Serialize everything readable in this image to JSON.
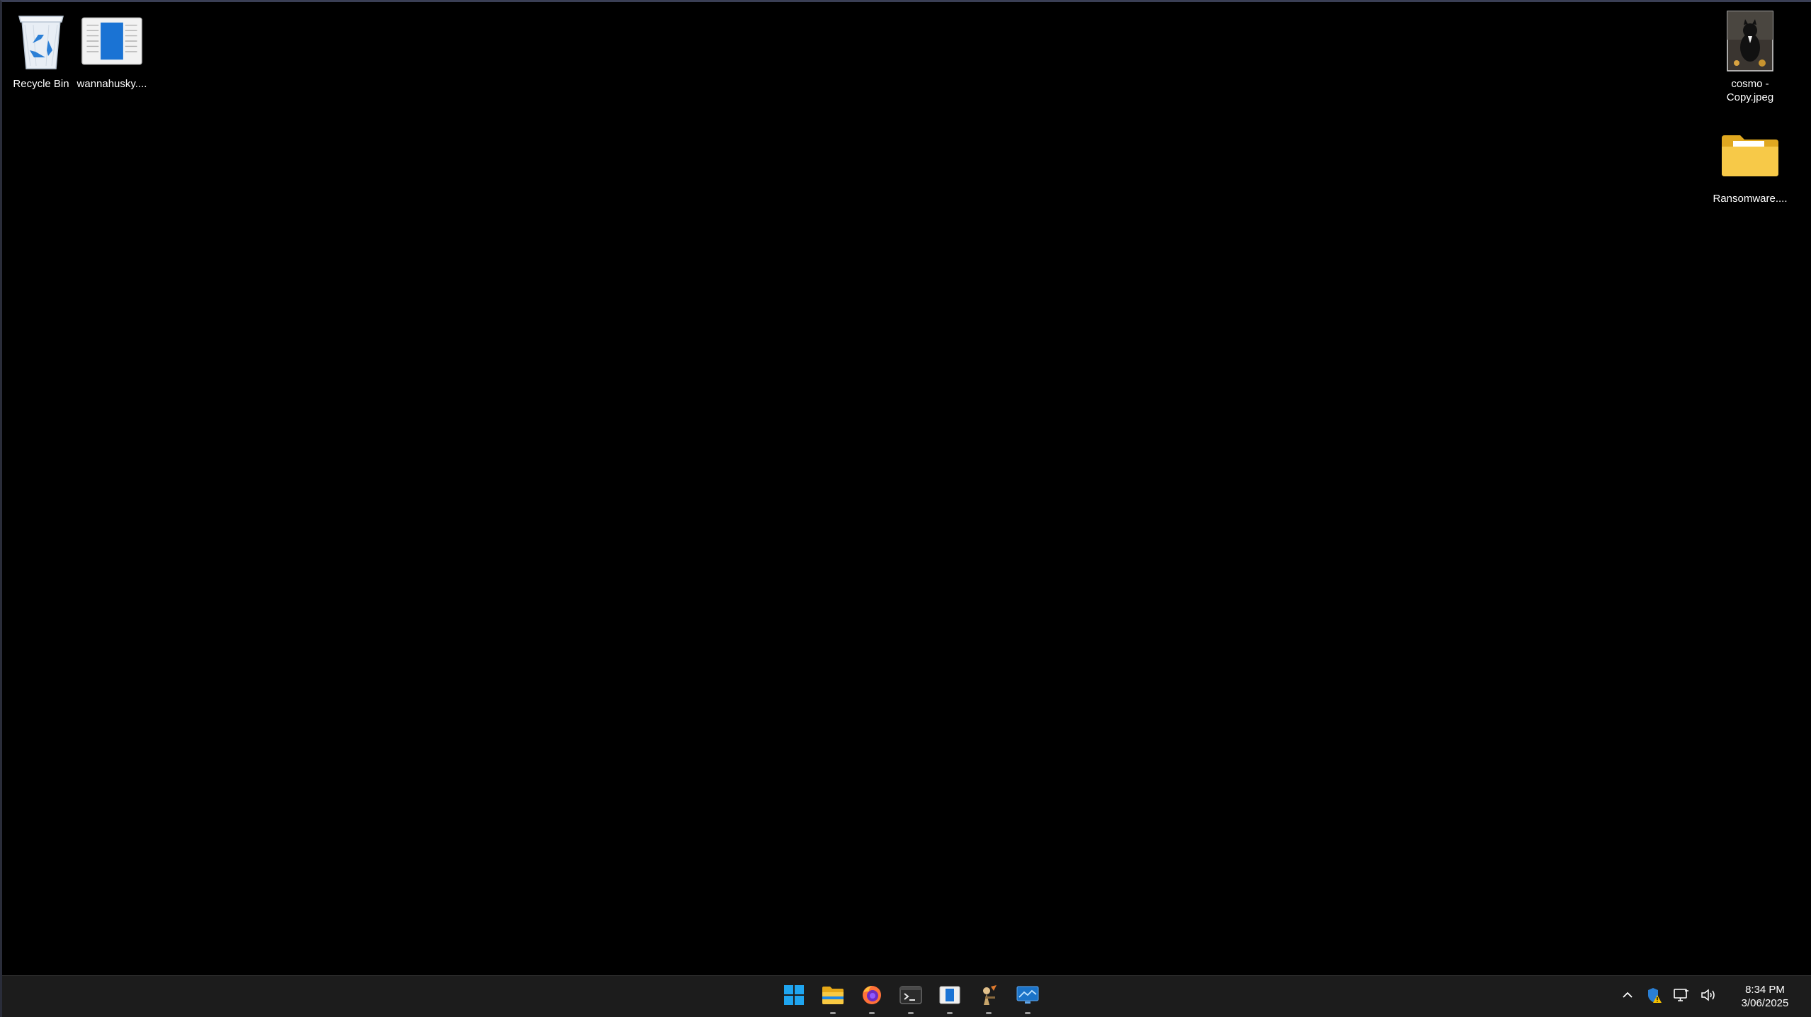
{
  "desktop": {
    "icons": [
      {
        "label": "Recycle Bin",
        "icon": "recycle-bin-icon"
      },
      {
        "label": "wannahusky....",
        "icon": "document-icon"
      },
      {
        "label": "cosmo - Copy.jpeg",
        "icon": "image-thumbnail-icon"
      },
      {
        "label": "Ransomware....",
        "icon": "folder-icon"
      }
    ]
  },
  "taskbar": {
    "apps": [
      {
        "name": "Start",
        "icon": "windows-start-icon",
        "running": false
      },
      {
        "name": "File Explorer",
        "icon": "file-explorer-icon",
        "running": true
      },
      {
        "name": "Firefox",
        "icon": "firefox-icon",
        "running": true
      },
      {
        "name": "Terminal",
        "icon": "terminal-icon",
        "running": true
      },
      {
        "name": "Document app",
        "icon": "document-app-icon",
        "running": true
      },
      {
        "name": "Tool app",
        "icon": "tool-app-icon",
        "running": true
      },
      {
        "name": "Remote desktop",
        "icon": "remote-desktop-icon",
        "running": true
      }
    ],
    "tray": {
      "icons": [
        "chevron-up-icon",
        "security-warning-icon",
        "network-icon",
        "volume-icon"
      ],
      "time": "8:34 PM",
      "date": "3/06/2025"
    }
  },
  "colors": {
    "desktop_background": "#000000",
    "taskbar_background": "#1c1c1c",
    "accent": "#0078d4",
    "folder": "#f5c542"
  }
}
